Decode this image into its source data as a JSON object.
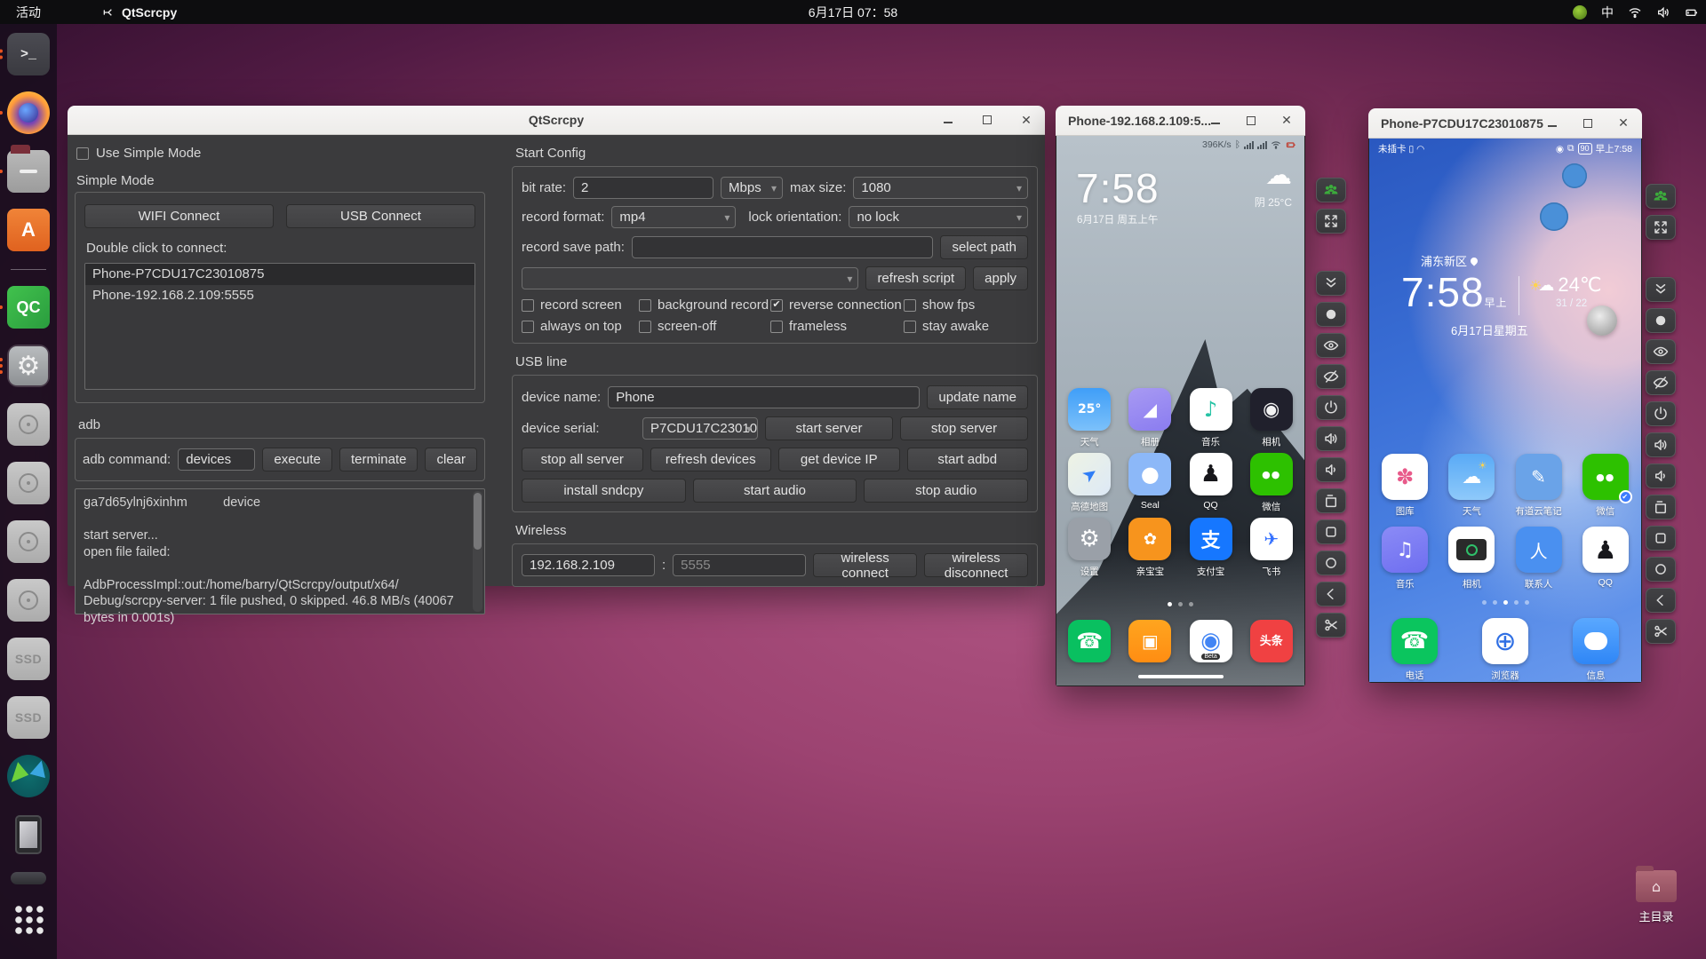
{
  "colors": {
    "accent_orange": "#e95420",
    "panel_bg": "#3b3b3d",
    "titlebar_bg": "#f2f1ef",
    "selection_bg": "#2a2a2c",
    "toolbar_group_green": "#3cab3c",
    "wechat_green": "#2dc100",
    "alipay_blue": "#1677ff",
    "toutiao_red": "#f04142"
  },
  "topbar": {
    "activities": "活动",
    "app_name": "QtScrcpy",
    "clock": "6月17日 07：58",
    "ime": "中"
  },
  "dock": {
    "qc_label": "QC",
    "ssd1": "SSD",
    "ssd2": "SSD"
  },
  "desktop": {
    "home_label": "主目录"
  },
  "main_window": {
    "title": "QtScrcpy",
    "simple": {
      "use_simple": "Use Simple Mode",
      "use_simple_checked": false,
      "group": "Simple Mode",
      "wifi": "WIFI Connect",
      "usb": "USB Connect",
      "hint": "Double click to connect:",
      "devices": [
        "Phone-P7CDU17C23010875",
        "Phone-192.168.2.109:5555"
      ]
    },
    "adb": {
      "label": "adb",
      "cmd_label": "adb command:",
      "cmd_value": "devices",
      "execute": "execute",
      "terminate": "terminate",
      "clear": "clear",
      "log": "ga7d65ylnj6xinhm          device\n\nstart server...\nopen file failed:\n\nAdbProcessImpl::out:/home/barry/QtScrcpy/output/x64/\nDebug/scrcpy-server: 1 file pushed, 0 skipped. 46.8 MB/s (40067\nbytes in 0.001s)"
    },
    "config": {
      "title": "Start Config",
      "bit_rate_label": "bit rate:",
      "bit_rate": "2",
      "mbps": "Mbps",
      "max_size_label": "max size:",
      "max_size": "1080",
      "record_format_label": "record format:",
      "record_format": "mp4",
      "lock_label": "lock orientation:",
      "lock": "no lock",
      "save_path_label": "record save path:",
      "save_path": "",
      "select_path": "select path",
      "script_value": "",
      "refresh_script": "refresh script",
      "apply": "apply",
      "checks": [
        {
          "label": "record screen",
          "checked": false
        },
        {
          "label": "background record",
          "checked": false
        },
        {
          "label": "reverse connection",
          "checked": true
        },
        {
          "label": "show fps",
          "checked": false
        },
        {
          "label": "always on top",
          "checked": false
        },
        {
          "label": "screen-off",
          "checked": false
        },
        {
          "label": "frameless",
          "checked": false
        },
        {
          "label": "stay awake",
          "checked": false
        }
      ]
    },
    "usb": {
      "title": "USB line",
      "name_label": "device name:",
      "name": "Phone",
      "update": "update name",
      "serial_label": "device serial:",
      "serial": "P7CDU17C23010",
      "start_server": "start server",
      "stop_server": "stop server",
      "stop_all": "stop all server",
      "refresh_devices": "refresh devices",
      "get_ip": "get device IP",
      "start_adbd": "start adbd",
      "install_sndcpy": "install sndcpy",
      "start_audio": "start audio",
      "stop_audio": "stop audio"
    },
    "wireless": {
      "title": "Wireless",
      "ip": "192.168.2.109",
      "colon": ":",
      "port_placeholder": "5555",
      "connect": "wireless connect",
      "disconnect": "wireless disconnect"
    }
  },
  "phone1": {
    "title": "Phone-192.168.2.109:5...",
    "status_speed": "396K/s",
    "clock": "7:58",
    "date": "6月17日 周五上午",
    "weather_cloud": "☁",
    "weather": "阴 25°C",
    "apps": [
      {
        "label": "天气",
        "glyph": "25°"
      },
      {
        "label": "相册",
        "glyph": "◢"
      },
      {
        "label": "音乐",
        "glyph": "♪"
      },
      {
        "label": "相机",
        "glyph": "◉"
      },
      {
        "label": "高德地图",
        "glyph": "➤"
      },
      {
        "label": "Seal",
        "glyph": "●"
      },
      {
        "label": "QQ",
        "glyph": "♟"
      },
      {
        "label": "微信",
        "glyph": "●●"
      },
      {
        "label": "设置",
        "glyph": "⚙"
      },
      {
        "label": "亲宝宝",
        "glyph": "✿"
      },
      {
        "label": "支付宝",
        "glyph": "支"
      },
      {
        "label": "飞书",
        "glyph": "✈"
      }
    ],
    "dock": [
      {
        "name": "phone",
        "glyph": "☎"
      },
      {
        "name": "messages",
        "glyph": "▣"
      },
      {
        "name": "chrome-beta",
        "glyph": "◉",
        "sub": "Beta"
      },
      {
        "name": "toutiao",
        "glyph": "头条"
      }
    ]
  },
  "phone2": {
    "title": "Phone-P7CDU17C23010875",
    "status_left": "未插卡",
    "battery": "90",
    "status_time": "早上7:58",
    "location": "浦东新区",
    "clock": "7:58",
    "ampm": "早上",
    "temp": "24℃",
    "hilo": "31 / 22",
    "date": "6月17日星期五",
    "sun": "☀",
    "cloud": "☁",
    "apps": [
      {
        "label": "图库",
        "glyph": "✽"
      },
      {
        "label": "天气",
        "glyph": "☁"
      },
      {
        "label": "有道云笔记",
        "glyph": "✎"
      },
      {
        "label": "微信",
        "glyph": "●●",
        "badge": "✔"
      },
      {
        "label": "音乐",
        "glyph": "♫"
      },
      {
        "label": "相机",
        "glyph": ""
      },
      {
        "label": "联系人",
        "glyph": "人"
      },
      {
        "label": "QQ",
        "glyph": "♟"
      }
    ],
    "dock": [
      {
        "label": "电话",
        "glyph": "☎"
      },
      {
        "label": "浏览器",
        "glyph": "⊕"
      },
      {
        "label": "信息",
        "glyph": ""
      }
    ]
  },
  "toolbar": {
    "buttons": [
      "group-control",
      "full-screen",
      "expand-notification",
      "screen-shot",
      "screen-on",
      "screen-off",
      "power",
      "volume-up",
      "volume-down",
      "app-switch",
      "menu",
      "home",
      "back",
      "clip"
    ]
  }
}
